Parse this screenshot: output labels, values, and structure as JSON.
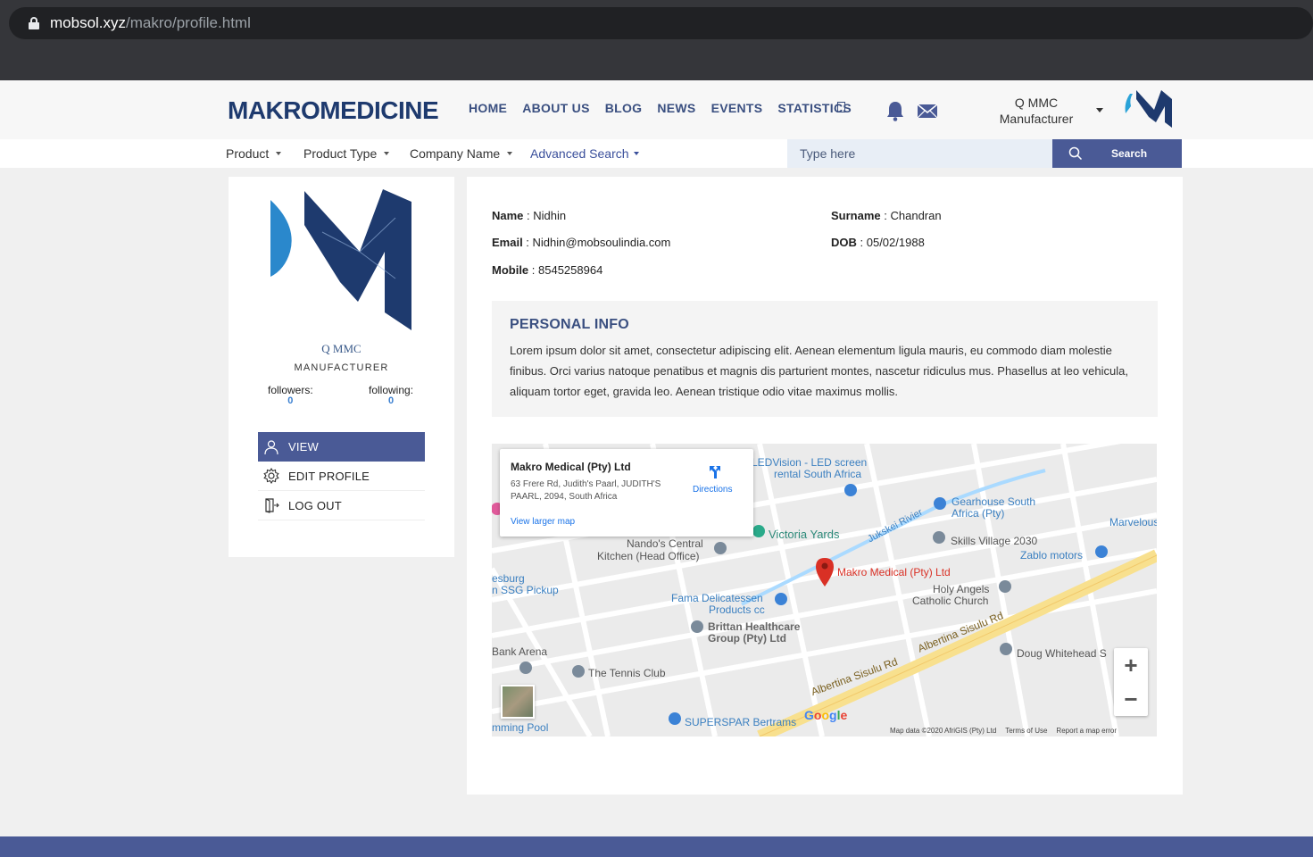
{
  "browser": {
    "url_domain": "mobsol.xyz",
    "url_path": "/makro/profile.html"
  },
  "header": {
    "logo_part1": "MAKRO",
    "logo_part2": "MEDICINE",
    "nav": [
      "HOME",
      "ABOUT US",
      "BLOG",
      "NEWS",
      "EVENTS",
      "STATISTICS"
    ],
    "user_name": "Q MMC",
    "user_role": "Manufacturer"
  },
  "filters": {
    "product": "Product",
    "product_type": "Product Type",
    "company_name": "Company Name",
    "advanced_search": "Advanced Search",
    "search_placeholder": "Type here",
    "search_button": "Search"
  },
  "profile": {
    "name": "Q MMC",
    "role": "MANUFACTURER",
    "followers_label": "followers:",
    "followers_count": "0",
    "following_label": "following:",
    "following_count": "0",
    "menu": {
      "view": "VIEW",
      "edit": "EDIT PROFILE",
      "logout": "LOG OUT"
    }
  },
  "details": {
    "name_label": "Name",
    "name_value": "Nidhin",
    "surname_label": "Surname",
    "surname_value": "Chandran",
    "email_label": "Email",
    "email_value": "Nidhin@mobsoulindia.com",
    "dob_label": "DOB",
    "dob_value": "05/02/1988",
    "mobile_label": "Mobile",
    "mobile_value": "8545258964"
  },
  "personal_info": {
    "title": "PERSONAL INFO",
    "text": "Lorem ipsum dolor sit amet, consectetur adipiscing elit. Aenean elementum ligula mauris, eu commodo diam molestie finibus. Orci varius natoque penatibus et magnis dis parturient montes, nascetur ridiculus mus. Phasellus at leo vehicula, aliquam tortor eget, gravida leo. Aenean tristique odio vitae maximus mollis."
  },
  "map": {
    "popup_title": "Makro Medical (Pty) Ltd",
    "popup_address": "63 Frere Rd, Judith's Paarl, JUDITH'S PAARL, 2094, South Africa",
    "popup_link": "View larger map",
    "popup_directions": "Directions",
    "labels": {
      "ledvision": "LEDVision - LED screen",
      "ledvision2": "rental South Africa",
      "gearhouse": "Gearhouse South",
      "gearhouse2": "Africa (Pty)",
      "marvelous": "Marvelous A",
      "victoria": "Victoria Yards",
      "jukskei": "Jukskei Rivier",
      "skills": "Skills Village 2030",
      "zablo": "Zablo motors",
      "nandos": "Nando's Central",
      "nandos2": "Kitchen (Head Office)",
      "makro": "Makro Medical (Pty) Ltd",
      "holy": "Holy Angels",
      "holy2": "Catholic Church",
      "fama": "Fama Delicatessen",
      "fama2": "Products cc",
      "brittan": "Brittan Healthcare",
      "brittan2": "Group (Pty) Ltd",
      "albertina": "Albertina Sisulu Rd",
      "albertina2": "Albertina Sisulu Rd",
      "doug": "Doug Whitehead S",
      "tennis": "The Tennis Club",
      "bank": "Bank Arena",
      "superspar": "SUPERSPAR Bertrams",
      "sburg": "esburg",
      "ssg": "n SSG Pickup",
      "pool": "mming Pool"
    },
    "google": "Google",
    "footer_data": "Map data ©2020 AfriGIS (Pty) Ltd",
    "footer_terms": "Terms of Use",
    "footer_report": "Report a map error",
    "zoom_in": "+",
    "zoom_out": "−"
  },
  "colors": {
    "primary": "#4a5a96",
    "nav": "#3a4f80",
    "accent": "#2aa3d8"
  }
}
